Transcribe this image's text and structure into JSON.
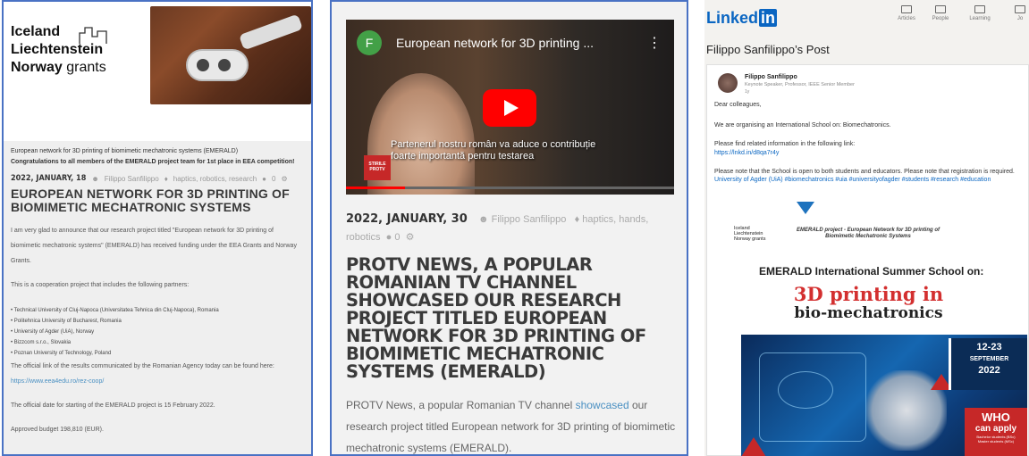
{
  "panel1": {
    "logo_line1": "Iceland",
    "logo_line2": "Liechtenstein",
    "logo_line3_bold": "Norway",
    "logo_line3_light": "grants",
    "project_line": "European network for 3D printing of biomimetic mechatronic systems (EMERALD)",
    "congrats": "Congratulations to all members of the EMERALD project team for 1st place in EEA competition!",
    "date": "2022, JANUARY, 18",
    "author": "Filippo Sanfilippo",
    "tags": "haptics, robotics, research",
    "comments": "0",
    "title": "EUROPEAN NETWORK FOR 3D PRINTING OF BIOMIMETIC MECHATRONIC SYSTEMS",
    "para1": "I am very glad to announce that our research project titled \"European network for 3D printing of biomimetic mechatronic systems\" (EMERALD) has received funding under the EEA Grants and Norway Grants.",
    "para2": "This is a cooperation project that includes the following partners:",
    "partners": [
      "Technical University of Cluj-Napoca (Universitatea Tehnica din Cluj-Napoca), Romania",
      "Politehnica University of Bucharest, Romania",
      "University of Agder (UiA), Norway",
      "Bizzcom s.r.o., Slovakia",
      "Poznan University of Technology, Poland"
    ],
    "para3_prefix": "The official link of the results communicated by the Romanian Agency today can be found here: ",
    "para3_link": "https://www.eea4edu.ro/rez-coop/",
    "para4": "The official date for starting of the EMERALD project is 15 February 2022.",
    "para5": "Approved budget 198,810 (EUR)."
  },
  "panel2": {
    "channel_initial": "F",
    "video_title": "European network for 3D printing ...",
    "video_menu": "⋮",
    "subtitle_line1": "Partenerul nostru român va aduce o contribuție",
    "subtitle_line2": "foarte importantă pentru testarea",
    "channel_logo": "STIRILE PROTV",
    "date": "2022, JANUARY, 30",
    "author": "Filippo Sanfilippo",
    "tags": "haptics, hands, robotics",
    "comments": "0",
    "title": "PROTV NEWS, A POPULAR ROMANIAN TV CHANNEL SHOWCASED OUR RESEARCH PROJECT TITLED EUROPEAN NETWORK FOR 3D PRINTING OF BIOMIMETIC MECHATRONIC SYSTEMS (EMERALD)",
    "text_prefix": "PROTV News, a popular Romanian TV channel ",
    "text_link": "showcased",
    "text_suffix": " our research project titled European network for 3D printing of biomimetic mechatronic systems (EMERALD)."
  },
  "panel3": {
    "logo_text": "Linked",
    "logo_in": "in",
    "nav": [
      "Articles",
      "People",
      "Learning",
      "Jo"
    ],
    "post_title": "Filippo Sanfilippo’s Post",
    "author": "Filippo Sanfilippo",
    "headline": "Keynote Speaker, Professor, IEEE Senior Member",
    "age": "1y",
    "greeting": "Dear colleagues,",
    "line1": "We are organising an International School on: Biomechatronics.",
    "line2": "Please find related information in the following link:",
    "link": "https://lnkd.in/d8qa7r4y",
    "line3_prefix": "Please note that the School is open to both students and educators. Please note that registration is required. ",
    "line3_tags": "University of Agder (UiA) #biomechatronics #uia #universityofagder #students #research #education",
    "emerald_logo_1": "Iceland",
    "emerald_logo_2": "Liechtenstein",
    "emerald_logo_3": "Norway grants",
    "emerald_project": "EMERALD project - European Network for 3D printing of Biomimetic Mechatronic Systems",
    "school_title": "EMERALD International Summer School on:",
    "big_red": "3D printing in",
    "big_black": "bio-mechatronics",
    "poster_dates": "12-23",
    "poster_month": "SEPTEMBER",
    "poster_year": "2022",
    "poster_who": "WHO",
    "poster_apply": "can apply",
    "poster_small1": "Bachelor students (BSc)",
    "poster_small2": "Master students (MSc)"
  }
}
